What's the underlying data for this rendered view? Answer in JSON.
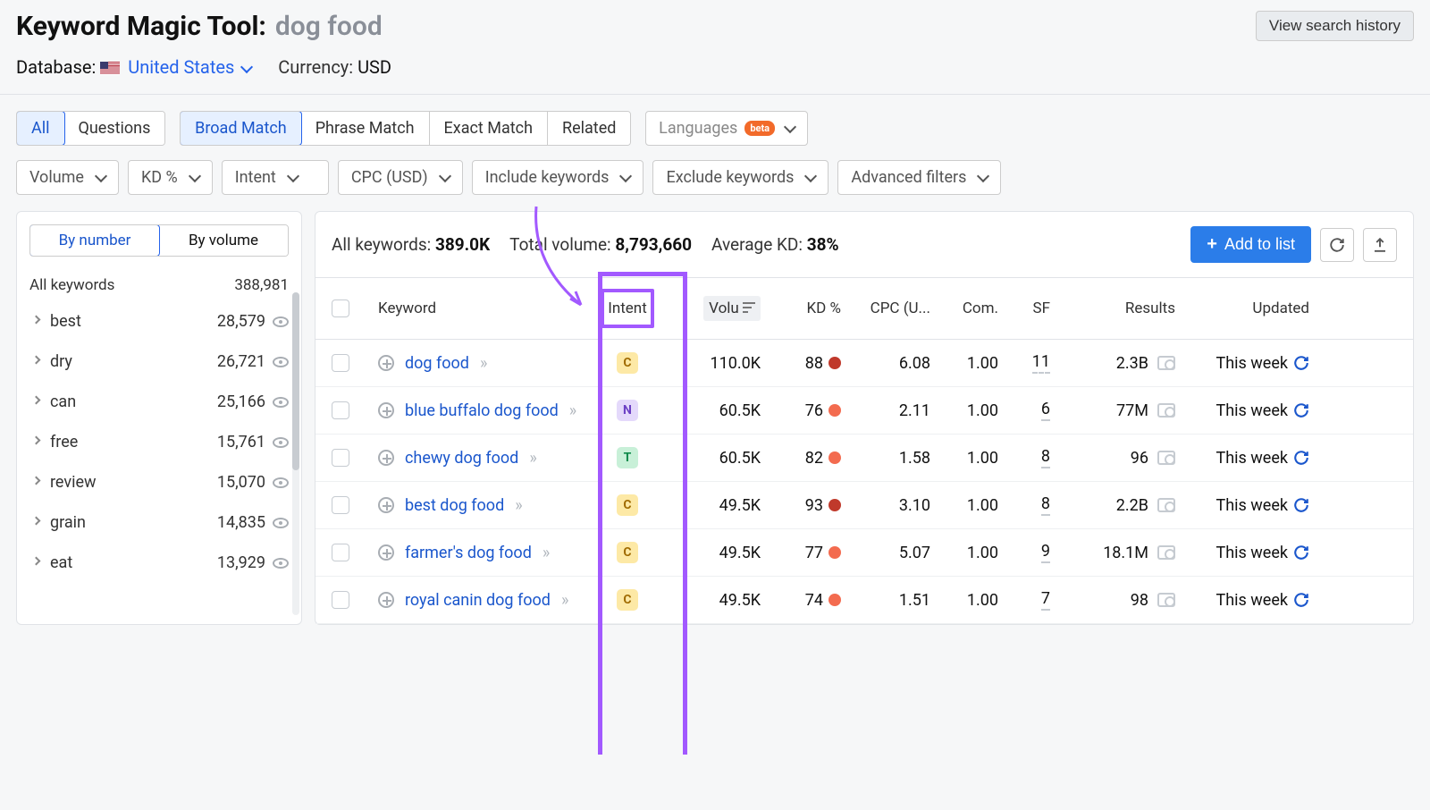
{
  "header": {
    "title_prefix": "Keyword Magic Tool:",
    "query": "dog food",
    "history_btn": "View search history",
    "database_label": "Database:",
    "database_value": "United States",
    "currency_label": "Currency:",
    "currency_value": "USD"
  },
  "match_tabs": {
    "all": "All",
    "questions": "Questions",
    "broad": "Broad Match",
    "phrase": "Phrase Match",
    "exact": "Exact Match",
    "related": "Related",
    "languages": "Languages",
    "beta": "beta"
  },
  "filters": {
    "volume": "Volume",
    "kd": "KD %",
    "intent": "Intent",
    "cpc": "CPC (USD)",
    "include": "Include keywords",
    "exclude": "Exclude keywords",
    "advanced": "Advanced filters"
  },
  "sidebar": {
    "by_number": "By number",
    "by_volume": "By volume",
    "all_label": "All keywords",
    "all_count": "388,981",
    "items": [
      {
        "term": "best",
        "count": "28,579"
      },
      {
        "term": "dry",
        "count": "26,721"
      },
      {
        "term": "can",
        "count": "25,166"
      },
      {
        "term": "free",
        "count": "15,761"
      },
      {
        "term": "review",
        "count": "15,070"
      },
      {
        "term": "grain",
        "count": "14,835"
      },
      {
        "term": "eat",
        "count": "13,929"
      }
    ]
  },
  "summary": {
    "all_kw_label": "All keywords:",
    "all_kw_value": "389.0K",
    "total_vol_label": "Total volume:",
    "total_vol_value": "8,793,660",
    "avg_kd_label": "Average KD:",
    "avg_kd_value": "38%",
    "add_to_list": "Add to list"
  },
  "columns": {
    "keyword": "Keyword",
    "intent": "Intent",
    "volume": "Volu",
    "kd": "KD %",
    "cpc": "CPC (U...",
    "com": "Com.",
    "sf": "SF",
    "results": "Results",
    "updated": "Updated"
  },
  "rows": [
    {
      "keyword": "dog food",
      "intent": "C",
      "volume": "110.0K",
      "kd": "88",
      "kd_color": "#c0392b",
      "cpc": "6.08",
      "com": "1.00",
      "sf": "11",
      "results": "2.3B",
      "updated": "This week"
    },
    {
      "keyword": "blue buffalo dog food",
      "intent": "N",
      "volume": "60.5K",
      "kd": "76",
      "kd_color": "#f36b4f",
      "cpc": "2.11",
      "com": "1.00",
      "sf": "6",
      "results": "77M",
      "updated": "This week"
    },
    {
      "keyword": "chewy dog food",
      "intent": "T",
      "volume": "60.5K",
      "kd": "82",
      "kd_color": "#f36b4f",
      "cpc": "1.58",
      "com": "1.00",
      "sf": "8",
      "results": "96",
      "updated": "This week"
    },
    {
      "keyword": "best dog food",
      "intent": "C",
      "volume": "49.5K",
      "kd": "93",
      "kd_color": "#c0392b",
      "cpc": "3.10",
      "com": "1.00",
      "sf": "8",
      "results": "2.2B",
      "updated": "This week"
    },
    {
      "keyword": "farmer's dog food",
      "intent": "C",
      "volume": "49.5K",
      "kd": "77",
      "kd_color": "#f36b4f",
      "cpc": "5.07",
      "com": "1.00",
      "sf": "9",
      "results": "18.1M",
      "updated": "This week"
    },
    {
      "keyword": "royal canin dog food",
      "intent": "C",
      "volume": "49.5K",
      "kd": "74",
      "kd_color": "#f36b4f",
      "cpc": "1.51",
      "com": "1.00",
      "sf": "7",
      "results": "98",
      "updated": "This week"
    }
  ]
}
